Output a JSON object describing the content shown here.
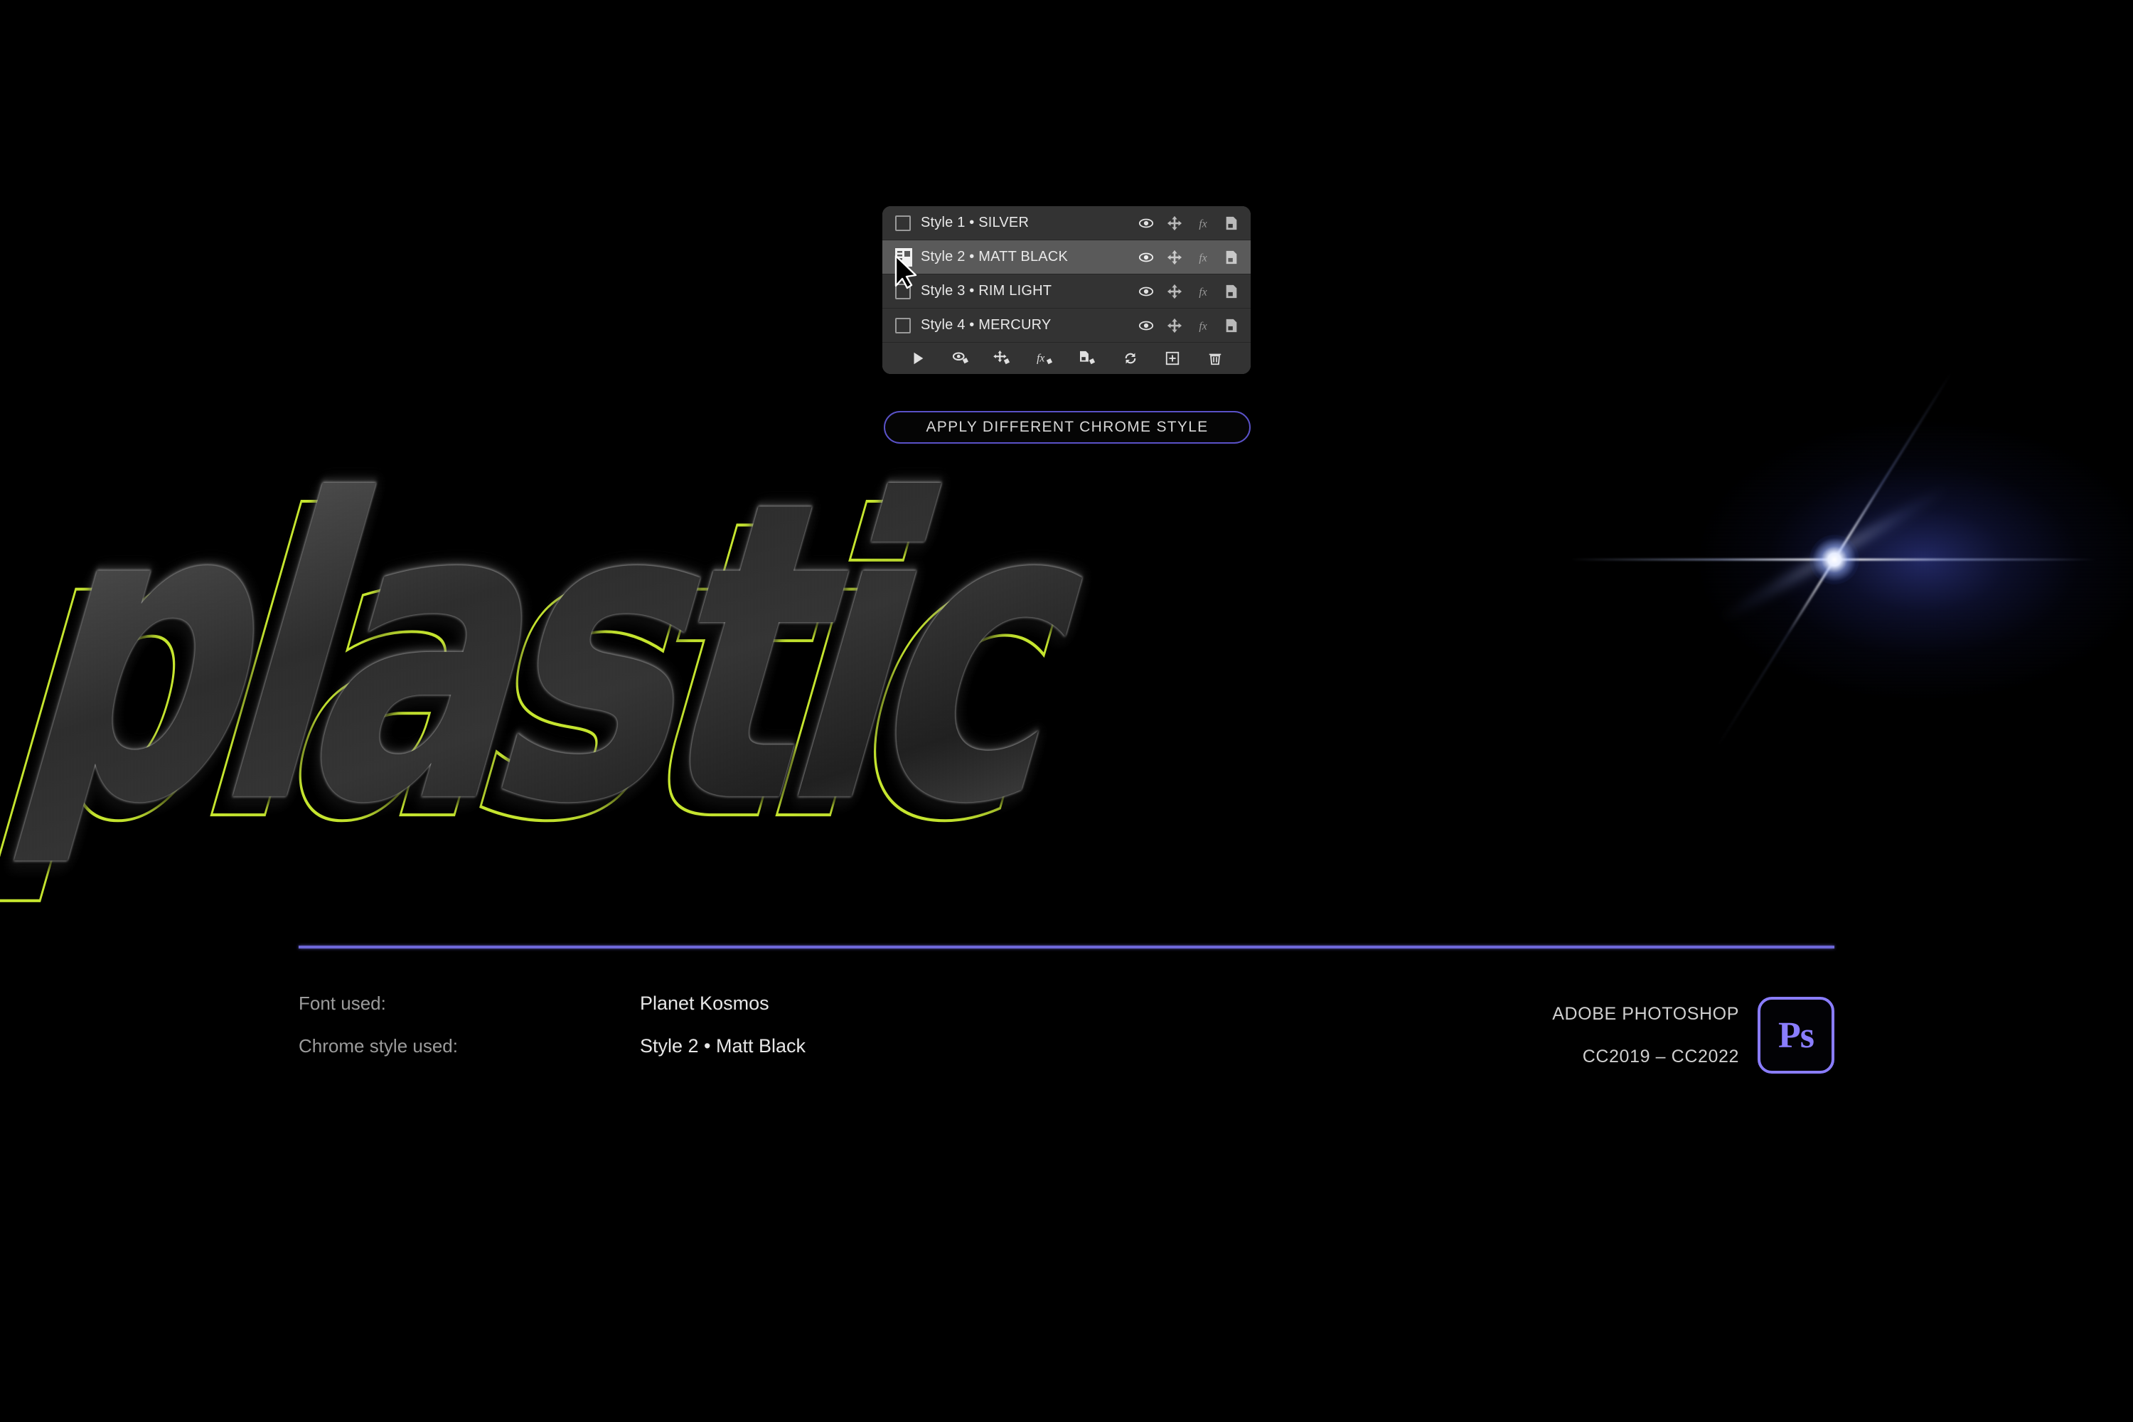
{
  "background_color": "#000000",
  "accent_colors": {
    "outline_green": "#c6e62e",
    "panel_bg": "#333333",
    "panel_selected": "#5a5a5a",
    "divider_purple": "#6d67d8",
    "button_border": "#5a52c8",
    "photoshop_purple": "#8a7dff"
  },
  "styles_panel": {
    "rows": [
      {
        "label": "Style 1 • SILVER",
        "selected": false,
        "icons": [
          "eye-icon",
          "move-icon",
          "fx-icon",
          "layer-icon"
        ]
      },
      {
        "label": "Style 2 • MATT BLACK",
        "selected": true,
        "icons": [
          "eye-icon",
          "move-icon",
          "fx-icon",
          "layer-icon"
        ]
      },
      {
        "label": "Style 3 • RIM LIGHT",
        "selected": false,
        "icons": [
          "eye-icon",
          "move-icon",
          "fx-icon",
          "layer-icon"
        ]
      },
      {
        "label": "Style 4 • MERCURY",
        "selected": false,
        "icons": [
          "eye-icon",
          "move-icon",
          "fx-icon",
          "layer-icon"
        ]
      }
    ],
    "toolbar_icons": [
      "play-icon",
      "toggle-visibility-icon",
      "move-action-icon",
      "fx-action-icon",
      "duplicate-action-icon",
      "refresh-icon",
      "new-action-icon",
      "trash-icon"
    ],
    "cursor": "arrow-cursor"
  },
  "apply_button": {
    "label": "APPLY DIFFERENT CHROME STYLE"
  },
  "artwork": {
    "word": "plastic",
    "effect": "matt-black-plastic-3d"
  },
  "footer": {
    "rows": [
      {
        "key": "Font used:",
        "value": "Planet Kosmos"
      },
      {
        "key": "Chrome style used:",
        "value": "Style 2 • Matt Black"
      }
    ],
    "right": {
      "line1": "ADOBE PHOTOSHOP",
      "line2": "CC2019 – CC2022",
      "logo_text": "Ps"
    }
  }
}
